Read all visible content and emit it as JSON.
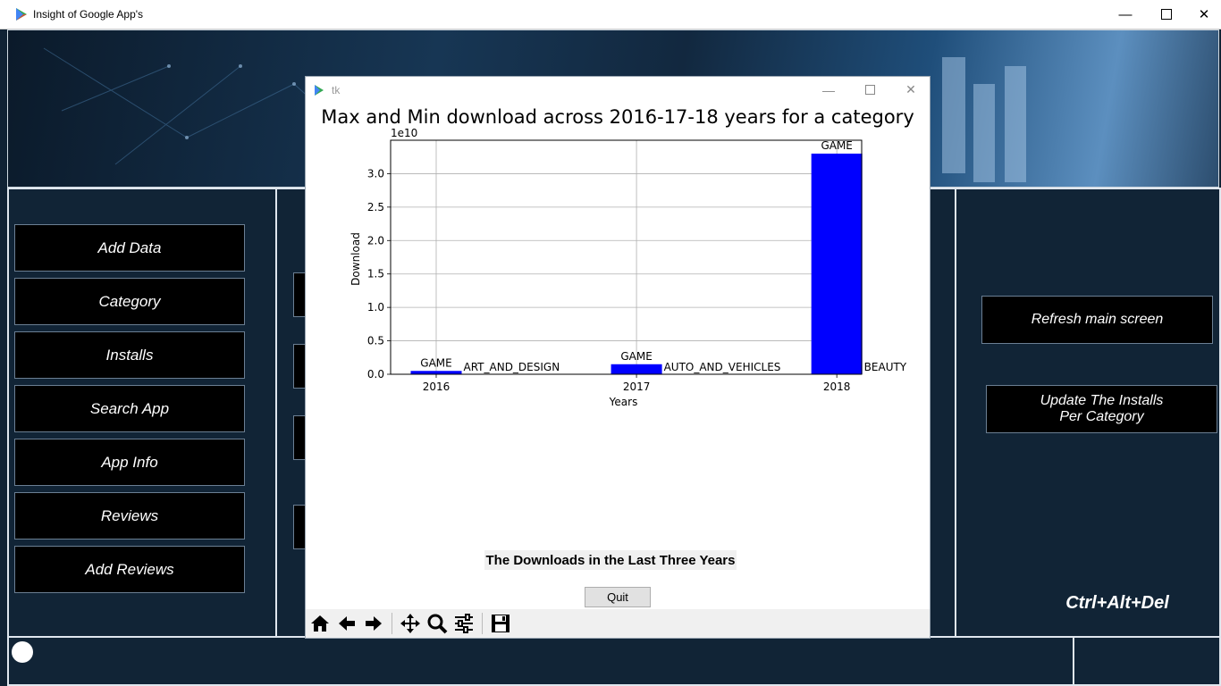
{
  "window": {
    "title": "Insight of Google App's"
  },
  "sidebar": {
    "buttons": [
      "Add Data",
      "Category",
      "Installs",
      "Search App",
      "App Info",
      "Reviews",
      "Add Reviews"
    ]
  },
  "right": {
    "refresh": "Refresh main screen",
    "update_line1": "Update The Installs",
    "update_line2": "Per Category",
    "shortcut": "Ctrl+Alt+Del"
  },
  "tk": {
    "title": "tk",
    "footer_label": "The Downloads in the Last Three Years",
    "quit": "Quit"
  },
  "colors": {
    "bar": "#0000ff",
    "panel_border": "#dfe6ee",
    "background": "#102234"
  },
  "icons": [
    "home-icon",
    "back-icon",
    "forward-icon",
    "pan-icon",
    "zoom-icon",
    "configure-icon",
    "save-icon"
  ],
  "chart_data": {
    "type": "bar",
    "title": "Max and Min download across 2016-17-18 years for a category",
    "xlabel": "Years",
    "ylabel": "Download",
    "offset_label": "1e10",
    "categories": [
      "2016",
      "2017",
      "2018"
    ],
    "series": [
      {
        "values": [
          0.05,
          0.15,
          3.3
        ],
        "labels": [
          "GAME",
          "GAME",
          "GAME"
        ]
      },
      {
        "values": [
          0.0,
          0.0,
          0.0
        ],
        "labels": [
          "ART_AND_DESIGN",
          "AUTO_AND_VEHICLES",
          "BEAUTY"
        ]
      }
    ],
    "ylim": [
      0,
      3.5
    ],
    "yticks": [
      "0.0",
      "0.5",
      "1.0",
      "1.5",
      "2.0",
      "2.5",
      "3.0"
    ],
    "grid": true
  }
}
